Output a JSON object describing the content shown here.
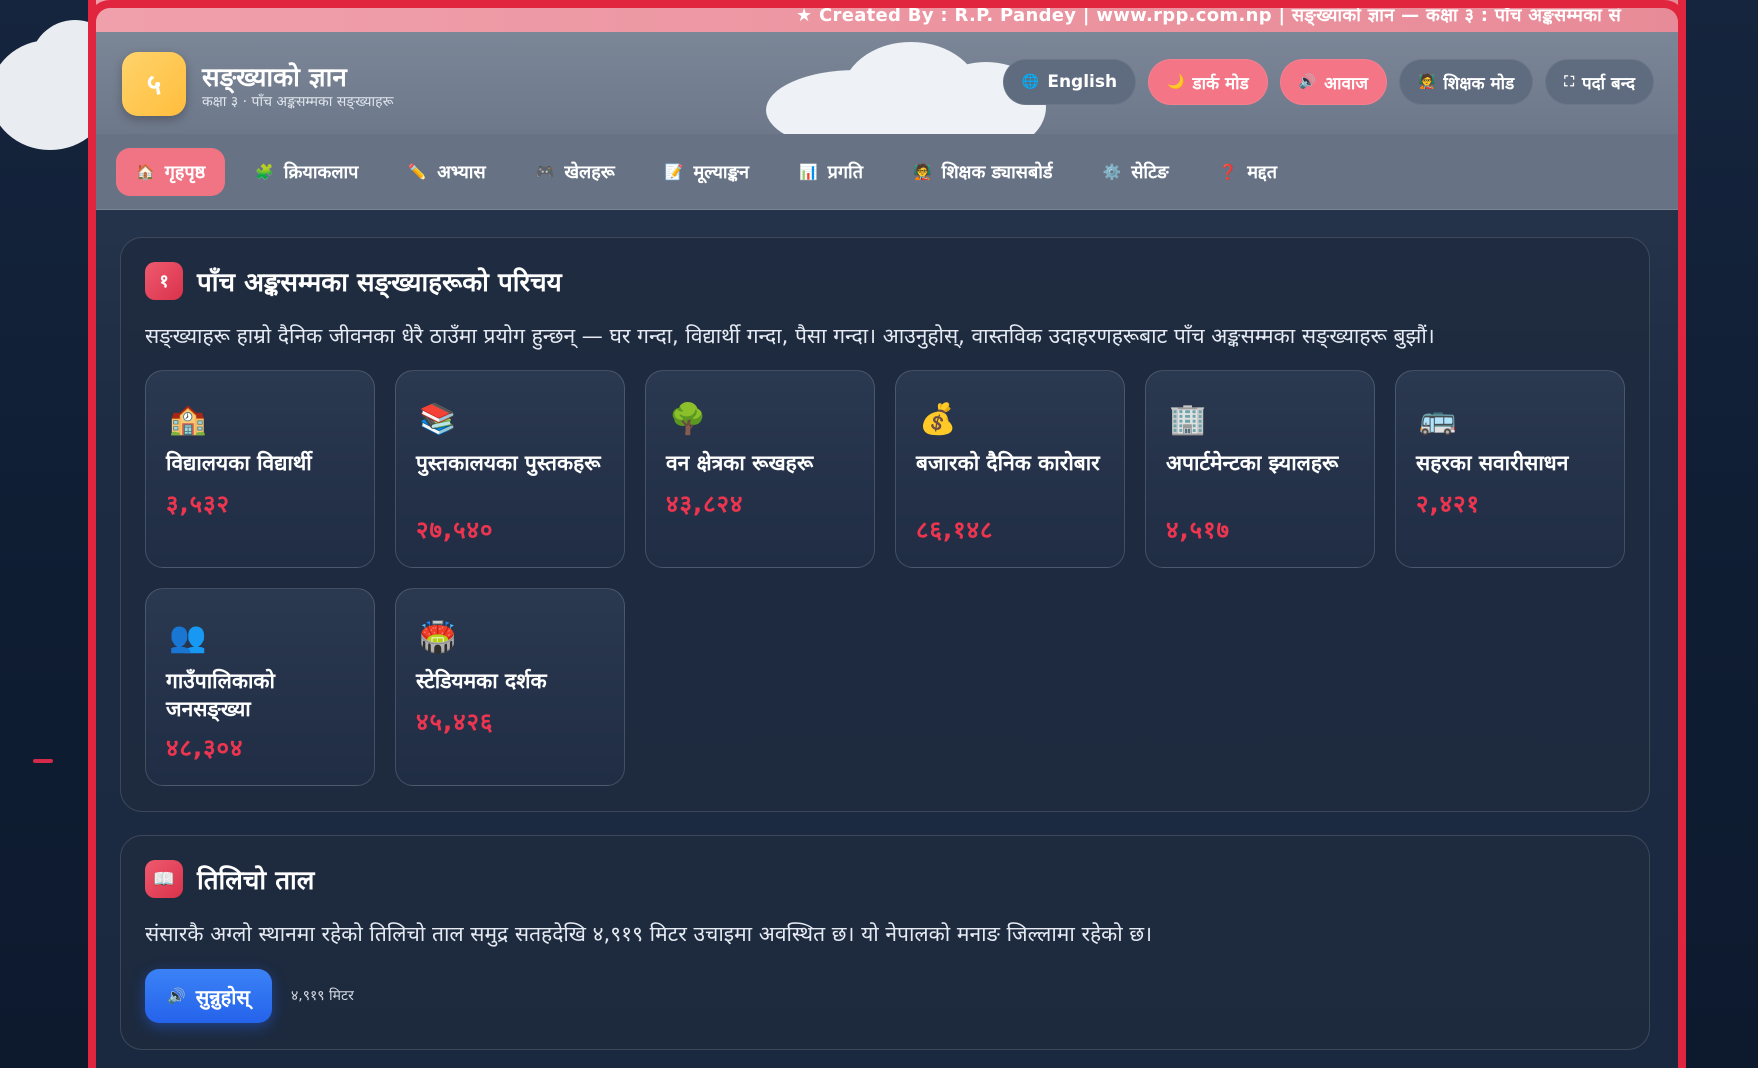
{
  "ticker": "★ Created By : R.P. Pandey  |  www.rpp.com.np  |  सङ्ख्याको ज्ञान — कक्षा ३ : पाँच अङ्कसम्मका सं",
  "logo": "५",
  "app": {
    "title": "सङ्ख्याको ज्ञान",
    "subtitle": "कक्षा ३ · पाँच अङ्कसम्मका सङ्ख्याहरू"
  },
  "header_buttons": [
    {
      "label": "English",
      "icon": "🌐"
    },
    {
      "label": "डार्क मोड",
      "icon": "🌙"
    },
    {
      "label": "आवाज",
      "icon": "🔊"
    },
    {
      "label": "शिक्षक मोड",
      "icon": "🧑‍🏫"
    },
    {
      "label": "पर्दा बन्द",
      "icon": "⛶"
    }
  ],
  "nav": [
    {
      "label": "गृहपृष्ठ",
      "icon": "🏠"
    },
    {
      "label": "क्रियाकलाप",
      "icon": "🧩"
    },
    {
      "label": "अभ्यास",
      "icon": "✏️"
    },
    {
      "label": "खेलहरू",
      "icon": "🎮"
    },
    {
      "label": "मूल्याङ्कन",
      "icon": "📝"
    },
    {
      "label": "प्रगति",
      "icon": "📊"
    },
    {
      "label": "शिक्षक ड्यासबोर्ड",
      "icon": "🧑‍🏫"
    },
    {
      "label": "सेटिङ",
      "icon": "⚙️"
    },
    {
      "label": "मद्दत",
      "icon": "❓"
    }
  ],
  "intro": {
    "badge": "१",
    "title": "पाँच अङ्कसम्मका सङ्ख्याहरूको परिचय",
    "description": "सङ्ख्याहरू हाम्रो दैनिक जीवनका धेरै ठाउँमा प्रयोग हुन्छन् — घर गन्दा, विद्यार्थी गन्दा, पैसा गन्दा। आउनुहोस्, वास्तविक उदाहरणहरूबाट पाँच अङ्कसम्मका सङ्ख्याहरू बुझौं।",
    "cards": [
      {
        "icon": "🏫",
        "label": "विद्यालयका विद्यार्थी",
        "value": "३,५३२"
      },
      {
        "icon": "📚",
        "label": "पुस्तकालयका पुस्तकहरू",
        "value": "२७,५४०"
      },
      {
        "icon": "🌳",
        "label": "वन क्षेत्रका रूखहरू",
        "value": "४३,८२४"
      },
      {
        "icon": "💰",
        "label": "बजारको दैनिक कारोबार",
        "value": "८६,१४८"
      },
      {
        "icon": "🏢",
        "label": "अपार्टमेन्टका झ्यालहरू",
        "value": "४,५१७"
      },
      {
        "icon": "🚌",
        "label": "सहरका सवारीसाधन",
        "value": "२,४२१"
      },
      {
        "icon": "👥",
        "label": "गाउँपालिकाको जनसङ्ख्या",
        "value": "४८,३०४"
      },
      {
        "icon": "🏟️",
        "label": "स्टेडियमका दर्शक",
        "value": "४५,४२६"
      }
    ]
  },
  "lake": {
    "badge": "📖",
    "title": "तिलिचो ताल",
    "description": "संसारकै अग्लो स्थानमा रहेको तिलिचो ताल समुद्र सतहदेखि ४,९१९ मिटर उचाइमा अवस्थित छ। यो नेपालको मनाङ जिल्लामा रहेको छ।",
    "listen_icon": "🔊",
    "listen_label": "सुन्नुहोस्",
    "note": "४,९१९ मिटर"
  }
}
